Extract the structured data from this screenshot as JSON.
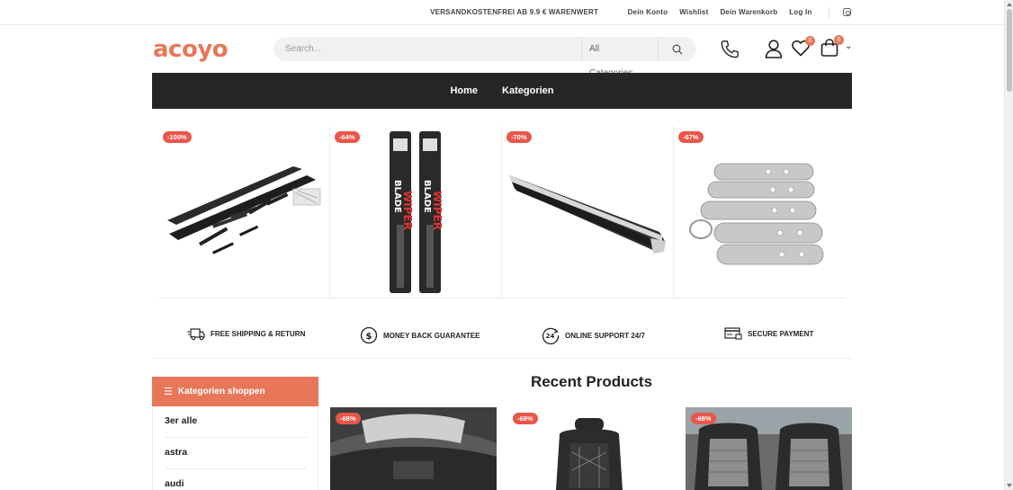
{
  "topbar": {
    "promo": "VERSANDKOSTENFREI AB 9.9 € WARENWERT",
    "links": [
      "Dein Konto",
      "Wishlist",
      "Dein Warenkorb",
      "Log In"
    ]
  },
  "header": {
    "logo": "acoyo",
    "search_placeholder": "Search...",
    "category_select": "All Categories",
    "wishlist_count": "0",
    "cart_count": "0"
  },
  "nav": [
    "Home",
    "Kategorien"
  ],
  "products": [
    {
      "discount": "-100%",
      "icon": "running-board-kit-image"
    },
    {
      "discount": "-64%",
      "icon": "wiper-blade-image"
    },
    {
      "discount": "-70%",
      "icon": "running-board-image"
    },
    {
      "discount": "-67%",
      "icon": "door-handle-covers-image"
    }
  ],
  "features": [
    {
      "label": "FREE SHIPPING & RETURN",
      "icon": "truck-icon"
    },
    {
      "label": "MONEY BACK GUARANTEE",
      "icon": "dollar-icon"
    },
    {
      "label": "ONLINE SUPPORT 24/7",
      "icon": "support-24-icon"
    },
    {
      "label": "SECURE PAYMENT",
      "icon": "credit-card-icon"
    }
  ],
  "sidebar": {
    "title": "Kategorien shoppen",
    "items": [
      "3er alle",
      "astra",
      "audi"
    ]
  },
  "recent": {
    "title": "Recent Products",
    "items": [
      {
        "discount": "-68%",
        "icon": "car-headliner-image"
      },
      {
        "discount": "-68%",
        "icon": "car-seat-image"
      },
      {
        "discount": "-68%",
        "icon": "car-seat-covers-image"
      }
    ]
  },
  "colors": {
    "accent": "#e8775a",
    "badge": "#e9564a",
    "nav_bg": "#262626"
  }
}
